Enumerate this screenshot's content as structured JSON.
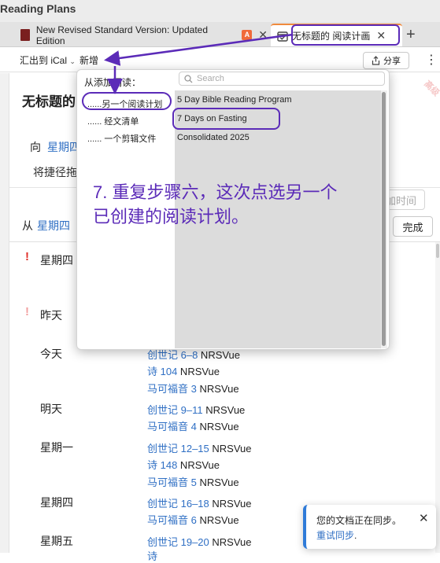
{
  "app": {
    "title": "Reading Plans"
  },
  "tabs": [
    {
      "label": "New Revised Standard Version: Updated Edition",
      "badge": "A"
    },
    {
      "label": "无标题的 阅读计画"
    }
  ],
  "toolbar": {
    "export_label": "汇出到 iCal",
    "add_label": "新增",
    "share_label": "分享"
  },
  "plan": {
    "title": "无标题的",
    "from_label": "向",
    "from_day": "星期四",
    "shortcut_text": "将捷径拖",
    "from2_label": "从",
    "from2_day": "星期四",
    "add_time_label": "加时间",
    "done_label": "完成"
  },
  "schedule": [
    {
      "day": "星期四",
      "warn": "!"
    },
    {
      "day": "昨天",
      "warn": "!"
    },
    {
      "day": "今天",
      "readings": [
        {
          "ref": "创世记 6–8",
          "version": " NRSVue"
        },
        {
          "ref": "诗 104",
          "version": " NRSVue"
        },
        {
          "ref": "马可福音 3",
          "version": " NRSVue"
        }
      ]
    },
    {
      "day": "明天",
      "readings": [
        {
          "ref": "创世记 9–11",
          "version": " NRSVue"
        },
        {
          "ref": "马可福音 4",
          "version": " NRSVue"
        }
      ]
    },
    {
      "day": "星期一",
      "readings": [
        {
          "ref": "创世记 12–15",
          "version": " NRSVue"
        },
        {
          "ref": "诗 148",
          "version": " NRSVue"
        },
        {
          "ref": "马可福音 5",
          "version": " NRSVue"
        }
      ]
    },
    {
      "day": "星期四",
      "readings": [
        {
          "ref": "创世记 16–18",
          "version": " NRSVue"
        },
        {
          "ref": "马可福音 6",
          "version": " NRSVue"
        }
      ]
    },
    {
      "day": "星期五",
      "readings": [
        {
          "ref": "创世记 19–20",
          "version": " NRSVue"
        },
        {
          "ref": "诗",
          "version": ""
        }
      ]
    }
  ],
  "popup": {
    "heading": "从添加阅读：",
    "search_placeholder": "Search",
    "options": [
      "......另一个阅读计划",
      "...... 经文清单",
      "...... 一个剪辑文件"
    ],
    "plans": [
      "5 Day Bible Reading Program",
      "7 Days on Fasting",
      "Consolidated 2025"
    ],
    "ribbon": "高级"
  },
  "instruction": {
    "line1": "7. 重复步骤六，这次点选另一个",
    "line2": "已创建的阅读计划。"
  },
  "toast": {
    "message": "您的文档正在同步。",
    "retry": "重试同步",
    "retry_suffix": "."
  },
  "colors": {
    "accent": "#5b2bb8",
    "link": "#2f6fc4",
    "warning": "#e0302a",
    "tab_active": "#f08a3c"
  },
  "icons": [
    "book-icon",
    "calendar-icon",
    "share-icon",
    "more-icon",
    "search-icon",
    "close-icon",
    "plus-icon",
    "chevron-down-icon"
  ]
}
